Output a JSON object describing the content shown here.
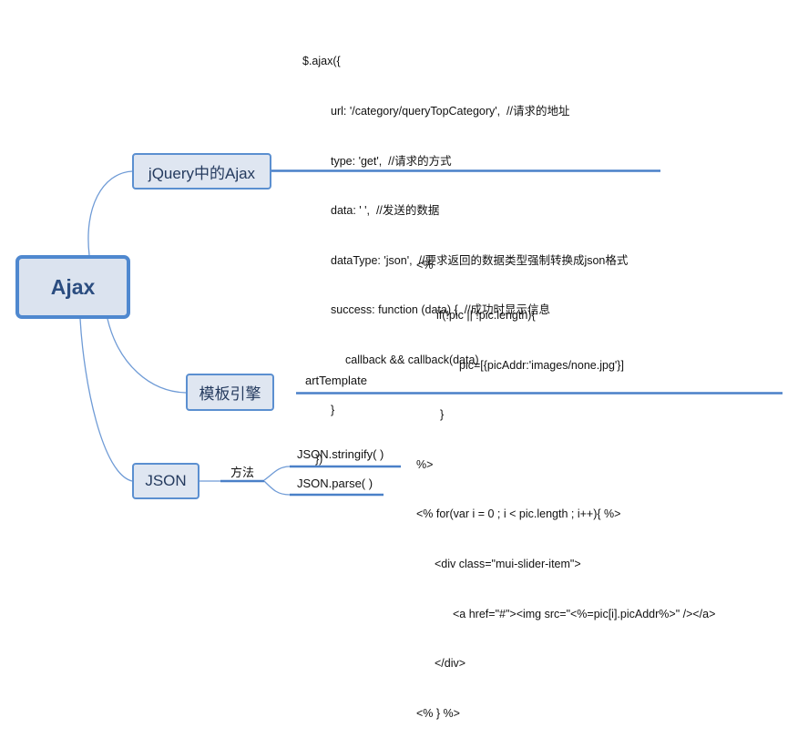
{
  "mindmap": {
    "root": "Ajax",
    "jquery_branch": {
      "label": "jQuery中的Ajax",
      "code_lines": [
        "$.ajax({",
        "url: '/category/queryTopCategory',  //请求的地址",
        "type: 'get',  //请求的方式",
        "data: ' ',  //发送的数据",
        "dataType: 'json',  //要求返回的数据类型强制转换成json格式",
        "success: function (data) {  //成功时显示信息",
        "callback && callback(data)",
        "}",
        "})"
      ]
    },
    "template_branch": {
      "label": "模板引擎",
      "sub_label": "artTemplate",
      "code_lines": [
        "<%",
        "if(!pic || !pic.length){",
        "pic=[{picAddr:'images/none.jpg'}]",
        "}",
        "%>",
        "<% for(var i = 0 ; i < pic.length ; i++){ %>",
        "<div class=\"mui-slider-item\">",
        "<a href=\"#\"><img src=\"<%=pic[i].picAddr%>\" /></a>",
        "</div>",
        "<% } %>"
      ]
    },
    "json_branch": {
      "label": "JSON",
      "sub_label": "方法",
      "methods": [
        "JSON.stringify( )",
        "JSON.parse( )"
      ]
    }
  },
  "colors": {
    "line": "#4a80c8",
    "node_fill": "#dfe6f1",
    "node_border": "#5b8fd0"
  }
}
